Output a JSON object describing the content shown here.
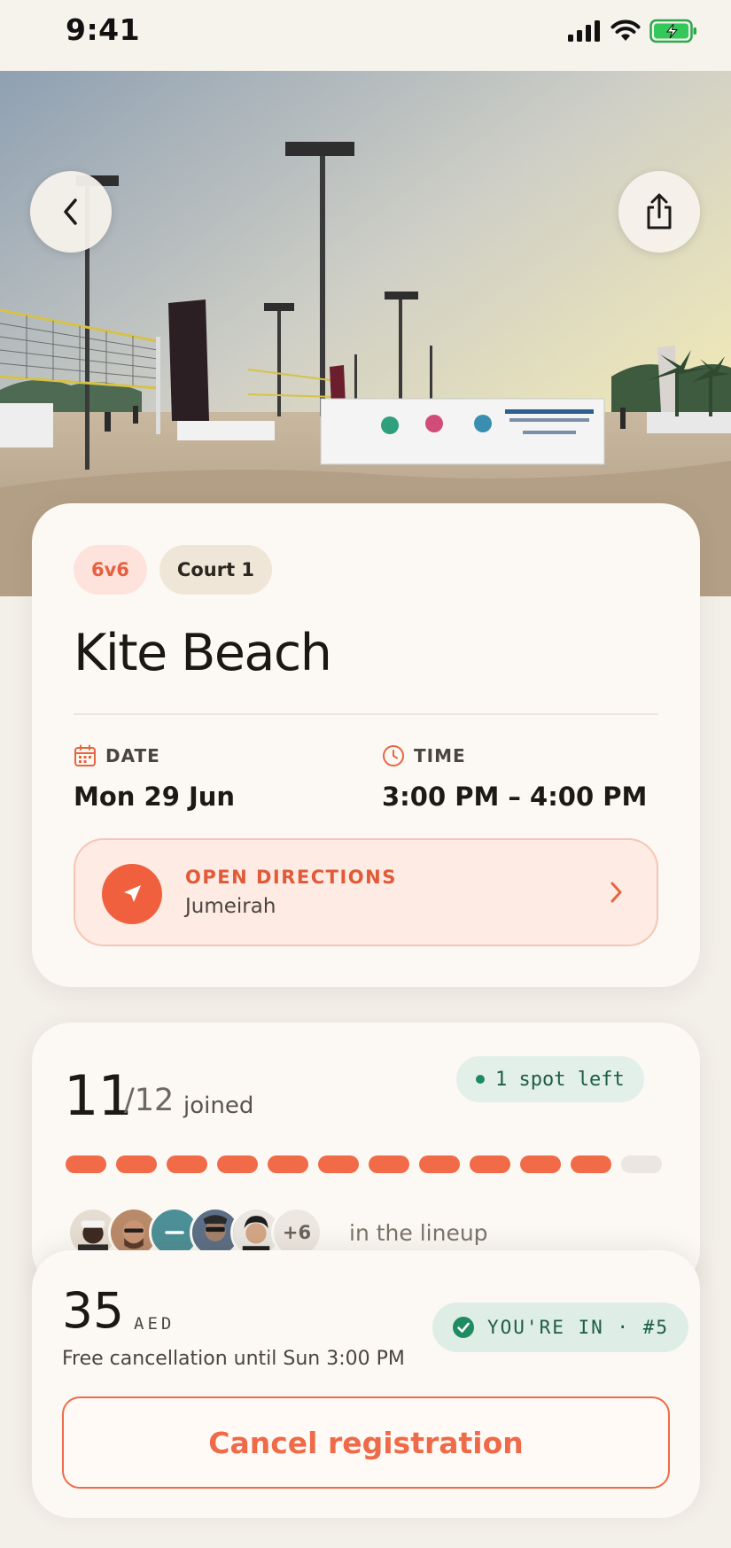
{
  "status_bar": {
    "time": "9:41"
  },
  "hero": {
    "back_icon": "chevron-left-icon",
    "share_icon": "share-icon"
  },
  "event": {
    "format_chip": "6v6",
    "court_chip": "Court 1",
    "title": "Kite Beach",
    "date_label": "DATE",
    "date_value": "Mon 29 Jun",
    "time_label": "TIME",
    "time_value": "3:00 PM – 4:00 PM",
    "directions_label": "OPEN DIRECTIONS",
    "directions_area": "Jumeirah"
  },
  "roster": {
    "joined": "11",
    "total": "/12",
    "joined_label": "joined",
    "spots_left": "1 spot left",
    "capacity": 12,
    "filled": 11,
    "more_count": "+6",
    "lineup_text": "in the lineup"
  },
  "footer": {
    "price": "35",
    "currency": "AED",
    "cancellation_note": "Free cancellation until Sun 3:00 PM",
    "status_badge": "YOU'RE IN · #5",
    "cancel_label": "Cancel registration"
  },
  "colors": {
    "accent": "#f0603f",
    "success": "#1f8b62",
    "background": "#f3efe9",
    "card": "#fcf9f4"
  }
}
